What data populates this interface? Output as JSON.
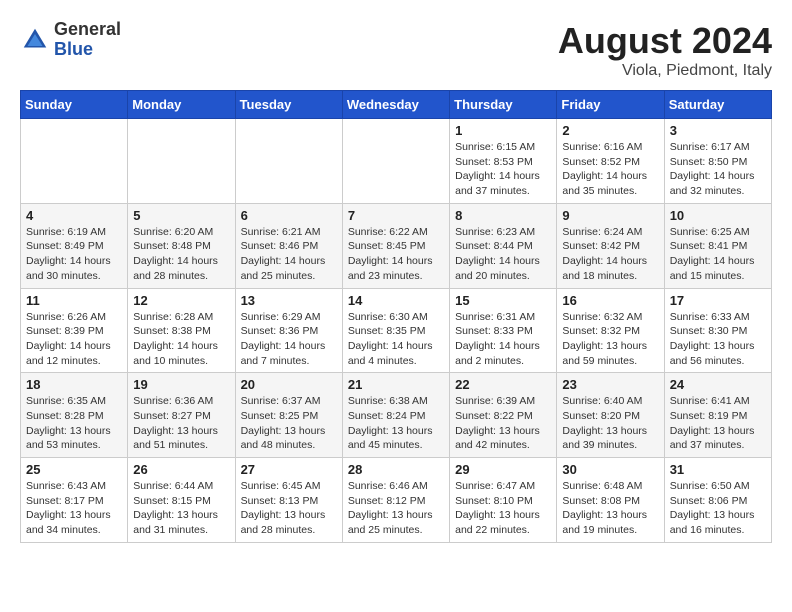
{
  "header": {
    "logo_general": "General",
    "logo_blue": "Blue",
    "main_title": "August 2024",
    "subtitle": "Viola, Piedmont, Italy"
  },
  "calendar": {
    "days_of_week": [
      "Sunday",
      "Monday",
      "Tuesday",
      "Wednesday",
      "Thursday",
      "Friday",
      "Saturday"
    ],
    "weeks": [
      [
        {
          "day": "",
          "info": ""
        },
        {
          "day": "",
          "info": ""
        },
        {
          "day": "",
          "info": ""
        },
        {
          "day": "",
          "info": ""
        },
        {
          "day": "1",
          "info": "Sunrise: 6:15 AM\nSunset: 8:53 PM\nDaylight: 14 hours\nand 37 minutes."
        },
        {
          "day": "2",
          "info": "Sunrise: 6:16 AM\nSunset: 8:52 PM\nDaylight: 14 hours\nand 35 minutes."
        },
        {
          "day": "3",
          "info": "Sunrise: 6:17 AM\nSunset: 8:50 PM\nDaylight: 14 hours\nand 32 minutes."
        }
      ],
      [
        {
          "day": "4",
          "info": "Sunrise: 6:19 AM\nSunset: 8:49 PM\nDaylight: 14 hours\nand 30 minutes."
        },
        {
          "day": "5",
          "info": "Sunrise: 6:20 AM\nSunset: 8:48 PM\nDaylight: 14 hours\nand 28 minutes."
        },
        {
          "day": "6",
          "info": "Sunrise: 6:21 AM\nSunset: 8:46 PM\nDaylight: 14 hours\nand 25 minutes."
        },
        {
          "day": "7",
          "info": "Sunrise: 6:22 AM\nSunset: 8:45 PM\nDaylight: 14 hours\nand 23 minutes."
        },
        {
          "day": "8",
          "info": "Sunrise: 6:23 AM\nSunset: 8:44 PM\nDaylight: 14 hours\nand 20 minutes."
        },
        {
          "day": "9",
          "info": "Sunrise: 6:24 AM\nSunset: 8:42 PM\nDaylight: 14 hours\nand 18 minutes."
        },
        {
          "day": "10",
          "info": "Sunrise: 6:25 AM\nSunset: 8:41 PM\nDaylight: 14 hours\nand 15 minutes."
        }
      ],
      [
        {
          "day": "11",
          "info": "Sunrise: 6:26 AM\nSunset: 8:39 PM\nDaylight: 14 hours\nand 12 minutes."
        },
        {
          "day": "12",
          "info": "Sunrise: 6:28 AM\nSunset: 8:38 PM\nDaylight: 14 hours\nand 10 minutes."
        },
        {
          "day": "13",
          "info": "Sunrise: 6:29 AM\nSunset: 8:36 PM\nDaylight: 14 hours\nand 7 minutes."
        },
        {
          "day": "14",
          "info": "Sunrise: 6:30 AM\nSunset: 8:35 PM\nDaylight: 14 hours\nand 4 minutes."
        },
        {
          "day": "15",
          "info": "Sunrise: 6:31 AM\nSunset: 8:33 PM\nDaylight: 14 hours\nand 2 minutes."
        },
        {
          "day": "16",
          "info": "Sunrise: 6:32 AM\nSunset: 8:32 PM\nDaylight: 13 hours\nand 59 minutes."
        },
        {
          "day": "17",
          "info": "Sunrise: 6:33 AM\nSunset: 8:30 PM\nDaylight: 13 hours\nand 56 minutes."
        }
      ],
      [
        {
          "day": "18",
          "info": "Sunrise: 6:35 AM\nSunset: 8:28 PM\nDaylight: 13 hours\nand 53 minutes."
        },
        {
          "day": "19",
          "info": "Sunrise: 6:36 AM\nSunset: 8:27 PM\nDaylight: 13 hours\nand 51 minutes."
        },
        {
          "day": "20",
          "info": "Sunrise: 6:37 AM\nSunset: 8:25 PM\nDaylight: 13 hours\nand 48 minutes."
        },
        {
          "day": "21",
          "info": "Sunrise: 6:38 AM\nSunset: 8:24 PM\nDaylight: 13 hours\nand 45 minutes."
        },
        {
          "day": "22",
          "info": "Sunrise: 6:39 AM\nSunset: 8:22 PM\nDaylight: 13 hours\nand 42 minutes."
        },
        {
          "day": "23",
          "info": "Sunrise: 6:40 AM\nSunset: 8:20 PM\nDaylight: 13 hours\nand 39 minutes."
        },
        {
          "day": "24",
          "info": "Sunrise: 6:41 AM\nSunset: 8:19 PM\nDaylight: 13 hours\nand 37 minutes."
        }
      ],
      [
        {
          "day": "25",
          "info": "Sunrise: 6:43 AM\nSunset: 8:17 PM\nDaylight: 13 hours\nand 34 minutes."
        },
        {
          "day": "26",
          "info": "Sunrise: 6:44 AM\nSunset: 8:15 PM\nDaylight: 13 hours\nand 31 minutes."
        },
        {
          "day": "27",
          "info": "Sunrise: 6:45 AM\nSunset: 8:13 PM\nDaylight: 13 hours\nand 28 minutes."
        },
        {
          "day": "28",
          "info": "Sunrise: 6:46 AM\nSunset: 8:12 PM\nDaylight: 13 hours\nand 25 minutes."
        },
        {
          "day": "29",
          "info": "Sunrise: 6:47 AM\nSunset: 8:10 PM\nDaylight: 13 hours\nand 22 minutes."
        },
        {
          "day": "30",
          "info": "Sunrise: 6:48 AM\nSunset: 8:08 PM\nDaylight: 13 hours\nand 19 minutes."
        },
        {
          "day": "31",
          "info": "Sunrise: 6:50 AM\nSunset: 8:06 PM\nDaylight: 13 hours\nand 16 minutes."
        }
      ]
    ]
  }
}
